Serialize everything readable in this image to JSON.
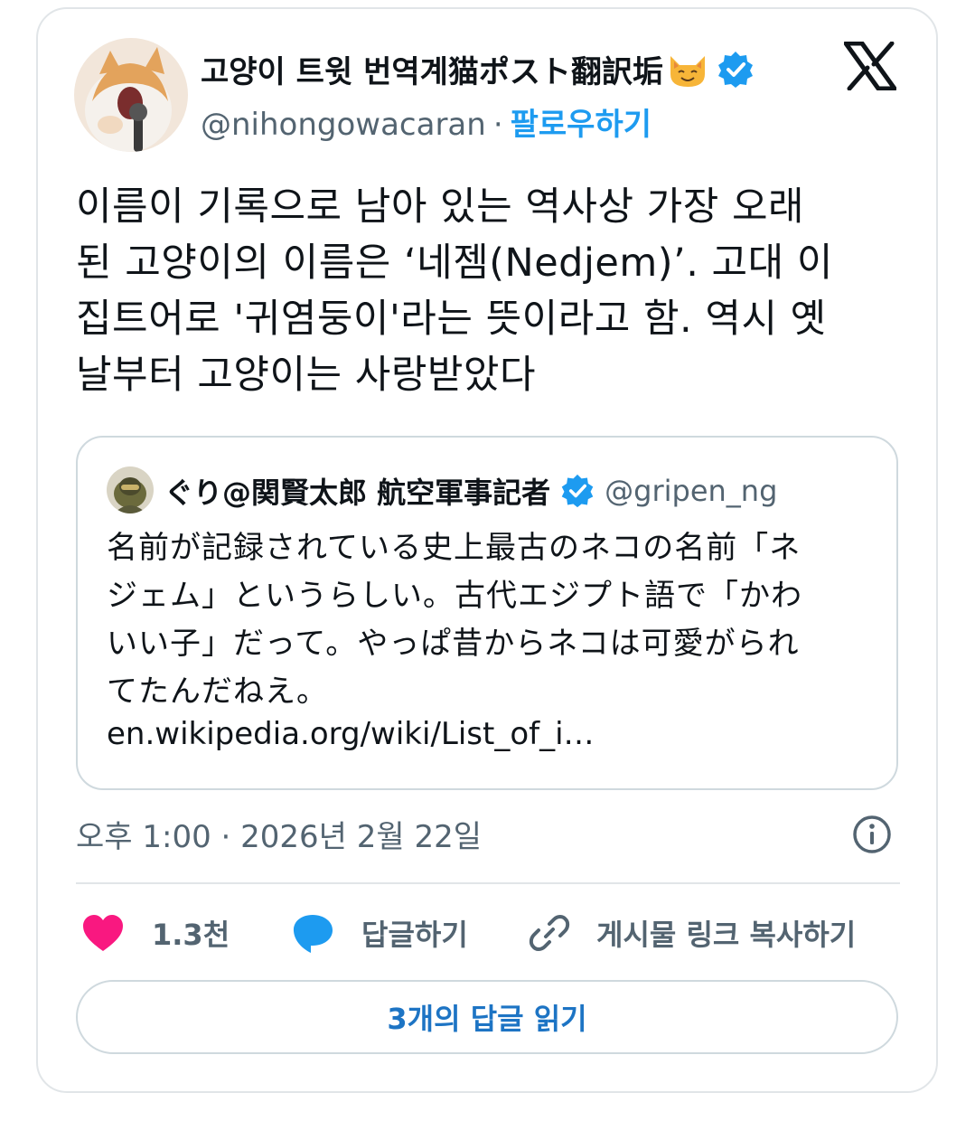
{
  "author": {
    "display_name": "고양이 트윗 번역계猫ポスト翻訳垢",
    "emoji_icon": "cat-face-emoji",
    "handle": "@nihongowacaran",
    "separator": "·",
    "follow_label": "팔로우하기"
  },
  "tweet": {
    "text": "이름이 기록으로 남아 있는 역사상 가장 오래\n된 고양이의 이름은 ‘네젬(Nedjem)’. 고대 이\n집트어로 '귀염둥이'라는 뜻이라고 함. 역시 옛\n날부터 고양이는 사랑받았다"
  },
  "quote": {
    "display_name": "ぐり@関賢太郎 航空軍事記者",
    "handle": "@gripen_ng",
    "text": "名前が記録されている史上最古のネコの名前「ネ\nジェム」というらしい。古代エジプト語で「かわ\nいい子」だって。やっぱ昔からネコは可愛がられ\nてたんだねえ。",
    "link": "en.wikipedia.org/wiki/List_of_i…"
  },
  "timestamp": "오후 1:00 · 2026년 2월 22일",
  "actions": {
    "like_count": "1.3천",
    "reply_label": "답글하기",
    "copy_link_label": "게시물 링크 복사하기"
  },
  "read_replies_label": "3개의 답글 읽기",
  "colors": {
    "accent": "#1d9bf0",
    "like": "#f91880",
    "muted": "#536471",
    "border": "#cfd9de"
  }
}
